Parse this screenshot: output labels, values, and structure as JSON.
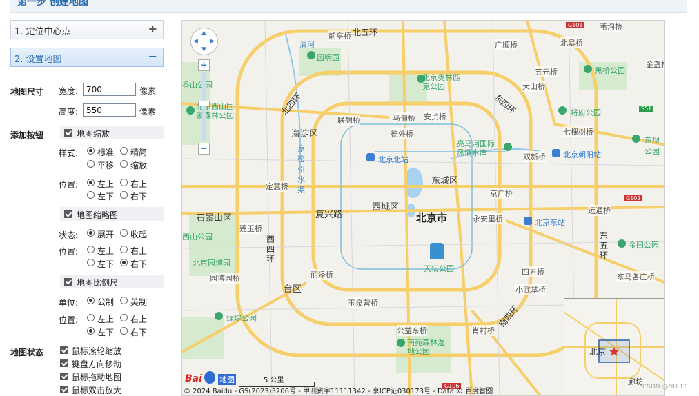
{
  "header": {
    "title": "第一步 创建地图"
  },
  "accordion": [
    {
      "label": "1. 定位中心点",
      "symbol": "+"
    },
    {
      "label": "2. 设置地图",
      "symbol": "−"
    }
  ],
  "size": {
    "section_label": "地图尺寸",
    "width_label": "宽度:",
    "width_value": "700",
    "width_unit": "像素",
    "height_label": "高度:",
    "height_value": "550",
    "height_unit": "像素"
  },
  "buttons": {
    "section_label": "添加按钮",
    "zoom": {
      "title": "地图缩放",
      "style_label": "样式:",
      "style_options": [
        "标准",
        "精简",
        "平移",
        "缩放"
      ],
      "style_selected": "标准",
      "position_label": "位置:",
      "position_options": [
        "左上",
        "右上",
        "左下",
        "右下"
      ],
      "position_selected": "左上"
    },
    "overview": {
      "title": "地图缩略图",
      "state_label": "状态:",
      "state_options": [
        "展开",
        "收起"
      ],
      "state_selected": "展开",
      "position_label": "位置:",
      "position_options": [
        "左上",
        "右上",
        "左下",
        "右下"
      ],
      "position_selected": "右下"
    },
    "scale": {
      "title": "地图比例尺",
      "unit_label": "单位:",
      "unit_options": [
        "公制",
        "英制"
      ],
      "unit_selected": "公制",
      "position_label": "位置:",
      "position_options": [
        "左上",
        "右上",
        "左下",
        "右下"
      ],
      "position_selected": "左下"
    }
  },
  "state": {
    "section_label": "地图状态",
    "options": [
      "鼠标滚轮缩放",
      "键盘方向移动",
      "鼠标拖动地图",
      "鼠标双击放大"
    ]
  },
  "map": {
    "labels": {
      "districts": [
        "海淀区",
        "东城区",
        "西城区",
        "石景山区",
        "丰台区"
      ],
      "city": "北京市",
      "roads": [
        "北五环",
        "北四环",
        "东四环",
        "西四环",
        "南四环",
        "东五环",
        "复兴路"
      ],
      "pois": [
        "圆明园",
        "北京奥林匹克公园",
        "北京西山国家森林公园",
        "黑桥公园",
        "将府公园",
        "东坝公园",
        "亮马河国际风情水岸",
        "北京北站",
        "北京朝阳站",
        "北京东站",
        "北京园博园",
        "绿堤公园",
        "南苑森林湿地公园",
        "金田公园",
        "天坛公园",
        "香山公园",
        "西山公园"
      ],
      "bridges": [
        "前亭桥",
        "广顺桥",
        "北皋桥",
        "苇沟桥",
        "五元桥",
        "大山桥",
        "金盏桥",
        "联想桥",
        "马甸桥",
        "安贞桥",
        "德外桥",
        "七棵树桥",
        "双新桥",
        "定慧桥",
        "京广桥",
        "远通桥",
        "永安里桥",
        "莲玉桥",
        "四方桥",
        "园博园桥",
        "丽泽桥",
        "小武基桥",
        "东马各庄桥",
        "玉泉营桥",
        "公益东桥",
        "肖村桥"
      ],
      "water": [
        "清河",
        "京密引水渠"
      ],
      "shields": [
        "G101",
        "S51",
        "G102",
        "G106"
      ]
    },
    "overview_labels": [
      "北京",
      "廊坊"
    ],
    "scale_label": "5 公里",
    "logo_text": "地图",
    "copyright": "© 2024 Baidu - GS(2023)3206号 - 甲测资字11111342 - 京ICP证030173号 - Data © 百度智图"
  },
  "watermark": "CSDN @NH.TT",
  "colors": {
    "accent": "#2a6cb0",
    "road_major": "#f7cf6a",
    "park": "#cfe6c4",
    "water": "#a8d2f0",
    "poi_green": "#3aa56d",
    "poi_blue": "#3b7fd4"
  }
}
